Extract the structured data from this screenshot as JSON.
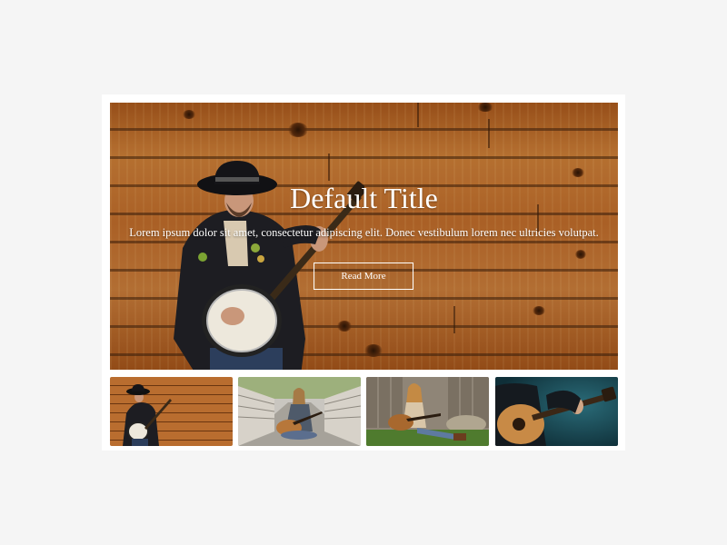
{
  "hero": {
    "title": "Default Title",
    "text": "Lorem ipsum dolor sit amet, consectetur adipiscing elit. Donec vestibulum lorem nec ultricies volutpat.",
    "button_label": "Read More"
  },
  "thumbnails": [
    {
      "subject": "banjo-player-on-wood-wall"
    },
    {
      "subject": "woman-with-guitar-on-bridge"
    },
    {
      "subject": "woman-with-guitar-by-fence"
    },
    {
      "subject": "guitarist-dark-background"
    }
  ],
  "colors": {
    "page_background": "#f5f5f5",
    "card_background": "#ffffff",
    "text": "#ffffff",
    "wood": "#b9692a"
  }
}
